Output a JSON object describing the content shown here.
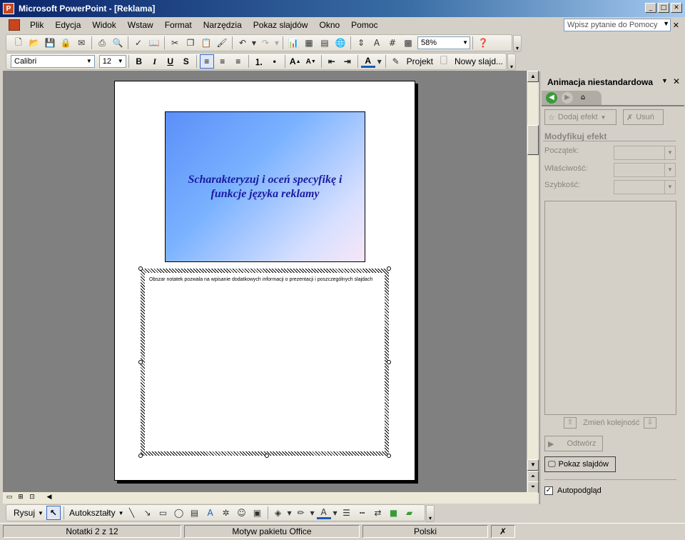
{
  "window": {
    "title": "Microsoft PowerPoint - [Reklama]",
    "app_icon": "P"
  },
  "menu": {
    "items": [
      "Plik",
      "Edycja",
      "Widok",
      "Wstaw",
      "Format",
      "Narzędzia",
      "Pokaz slajdów",
      "Okno",
      "Pomoc"
    ],
    "help_placeholder": "Wpisz pytanie do Pomocy"
  },
  "standard_toolbar": {
    "zoom": "58%"
  },
  "format_toolbar": {
    "font": "Calibri",
    "size": "12",
    "bold": "B",
    "italic": "I",
    "underline": "U",
    "shadow": "S",
    "design_label": "Projekt",
    "new_slide_label": "Nowy slajd..."
  },
  "slide": {
    "title": "Scharakteryzuj i oceń specyfikę i funkcje języka reklamy"
  },
  "notes": {
    "text": "Obszar notatek pozwala na wpisanie dodatkowych informacji o prezentacji i poszczególnych slajdach"
  },
  "task_pane": {
    "title": "Animacja niestandardowa",
    "add_effect": "Dodaj efekt",
    "remove": "Usuń",
    "modify_section": "Modyfikuj efekt",
    "start_label": "Początek:",
    "property_label": "Właściwość:",
    "speed_label": "Szybkość:",
    "reorder_label": "Zmień kolejność",
    "play_label": "Odtwórz",
    "slideshow_label": "Pokaz slajdów",
    "autopreview_label": "Autopodgląd",
    "autopreview_checked": true
  },
  "drawing_toolbar": {
    "draw_label": "Rysuj",
    "autoshapes_label": "Autokształty"
  },
  "status": {
    "notes_pos": "Notatki 2 z 12",
    "theme": "Motyw pakietu Office",
    "language": "Polski"
  }
}
